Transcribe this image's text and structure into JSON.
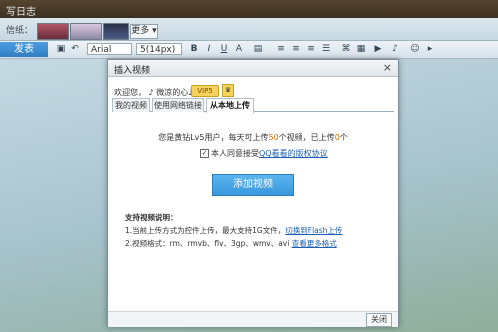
{
  "window": {
    "title": "写日志"
  },
  "background_strip": {
    "label": "信纸：",
    "more_label": "更多 ▾"
  },
  "toolbar": {
    "publish_label": "发表",
    "font_name": "Arial",
    "font_size": "5(14px)",
    "bold": "B",
    "italic": "I",
    "underline": "U",
    "font_color": "A"
  },
  "dialog": {
    "title": "插入视频",
    "welcome": "欢迎您，  ♪ 微凉的心♪",
    "vip_badge": "VIP5",
    "tabs": [
      "我的视频",
      "使用网络链接",
      "从本地上传"
    ],
    "quota_prefix": "您是黄钻Lv5用户，每天可上传",
    "quota_limit": "50",
    "quota_mid": "个视频，已上传",
    "quota_used": "0",
    "quota_suffix": "个",
    "agree_text": "本人同意接受",
    "agree_link": "QQ看看的版权协议",
    "add_button": "添加视频",
    "notes_title": "支持视频说明：",
    "note1": "1.当前上传方式为控件上传，最大支持1G文件，",
    "note1_link": "切换到Flash上传",
    "note2": "2.视频格式：rm、rmvb、flv、3gp、wmv、avi",
    "note2_link": "查看更多格式",
    "close_button": "关闭"
  }
}
